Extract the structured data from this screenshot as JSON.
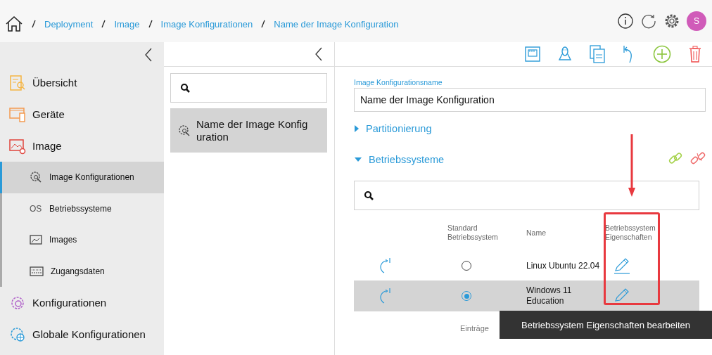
{
  "breadcrumb": [
    "Deployment",
    "Image",
    "Image Konfigurationen",
    "Name der Image Konfiguration"
  ],
  "header": {
    "avatar": "S"
  },
  "sidebar": {
    "items": [
      {
        "label": "Übersicht",
        "selected": false
      },
      {
        "label": "Geräte",
        "selected": false
      },
      {
        "label": "Image",
        "selected": false,
        "expanded": true,
        "children": [
          {
            "label": "Image Konfigurationen",
            "selected": true
          },
          {
            "label": "Betriebssysteme",
            "selected": false,
            "icon_text": "OS"
          },
          {
            "label": "Images",
            "selected": false
          },
          {
            "label": "Zugangsdaten",
            "selected": false
          }
        ]
      },
      {
        "label": "Konfigurationen",
        "selected": false
      },
      {
        "label": "Globale Konfigurationen",
        "selected": false
      }
    ]
  },
  "list": {
    "items": [
      {
        "label": "Name der Image Konfiguration",
        "selected": true
      }
    ]
  },
  "form": {
    "label": "Image Konfigurationsname",
    "value": "Name der Image Konfiguration"
  },
  "sections": [
    {
      "title": "Partitionierung",
      "expanded": false
    },
    {
      "title": "Betriebssysteme",
      "expanded": true
    }
  ],
  "table": {
    "columns": [
      "Standard Betriebssystem",
      "Name",
      "Betriebssystem Eigenschaften"
    ],
    "rows": [
      {
        "name": "Linux Ubuntu 22.04",
        "default": false,
        "selected": false
      },
      {
        "name": "Windows 11 Education",
        "default": true,
        "selected": true
      }
    ]
  },
  "footer": {
    "label": "Einträge"
  },
  "tooltip": "Betriebssystem Eigenschaften bearbeiten"
}
